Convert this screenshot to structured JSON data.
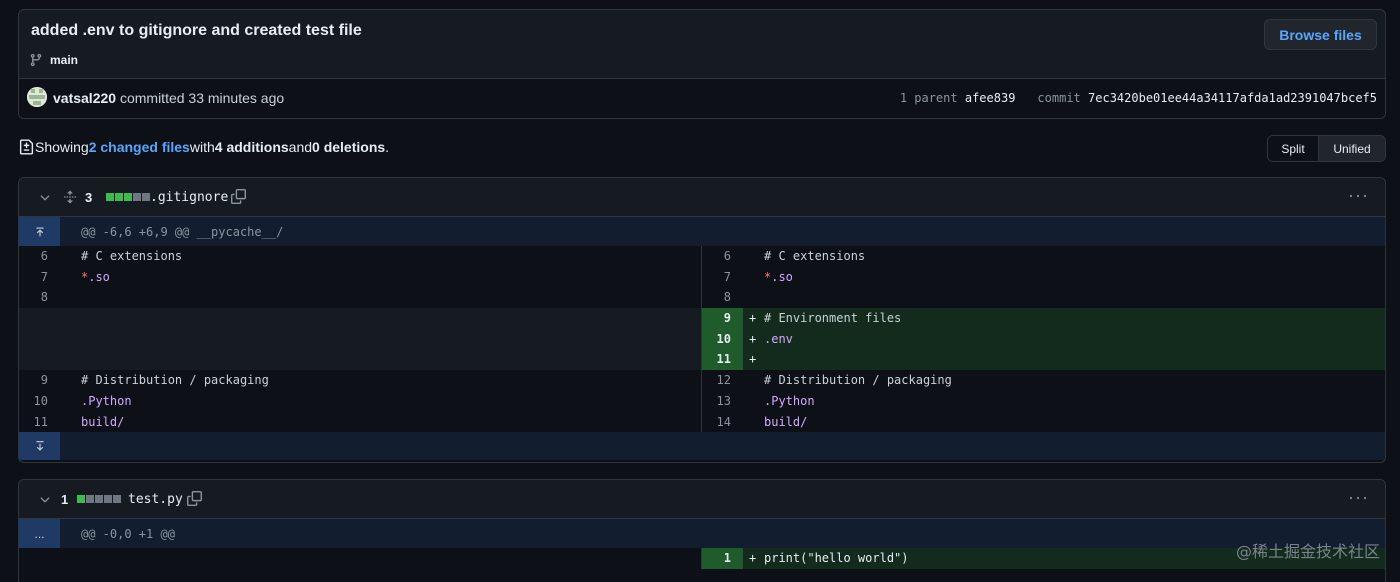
{
  "commit": {
    "title": "added .env to gitignore and created test file",
    "branch": "main",
    "browse_label": "Browse files",
    "author": "vatsal220",
    "author_suffix": " committed 33 minutes ago",
    "parent_label": "1 parent",
    "parent_sha": "afee839",
    "commit_label": "commit",
    "commit_sha": "7ec3420be01ee44a34117afda1ad2391047bcef5"
  },
  "summary": {
    "showing": "Showing ",
    "changed": "2 changed files",
    "with": " with ",
    "additions": "4 additions",
    "and": " and ",
    "deletions": "0 deletions",
    "end": "."
  },
  "view_toggle": {
    "split": "Split",
    "unified": "Unified"
  },
  "files": [
    {
      "count": "3",
      "name": ".gitignore",
      "hunk": "@@ -6,6 +6,9 @@ __pycache__/",
      "lines": {
        "l6": "6",
        "l7": "7",
        "l8": "8",
        "l9": "9",
        "l10": "10",
        "l11": "11",
        "r6": "6",
        "r7": "7",
        "r8": "8",
        "r9": "9",
        "r10": "10",
        "r11": "11",
        "r12": "12",
        "r13": "13",
        "r14": "14",
        "c_ext": "# C extensions",
        "so_star": "*",
        "so_rest": ".so",
        "env_files": "# Environment files",
        "env": ".env",
        "plus": "+",
        "dist": "# Distribution / packaging",
        "python": ".Python",
        "build": "build/"
      }
    },
    {
      "count": "1",
      "name": "test.py",
      "hunk": "@@ -0,0 +1 @@",
      "expand": "...",
      "lines": {
        "r1": "1",
        "plus": "+",
        "print": "print(\"hello world\")"
      }
    }
  ],
  "watermark": "@稀土掘金技术社区"
}
